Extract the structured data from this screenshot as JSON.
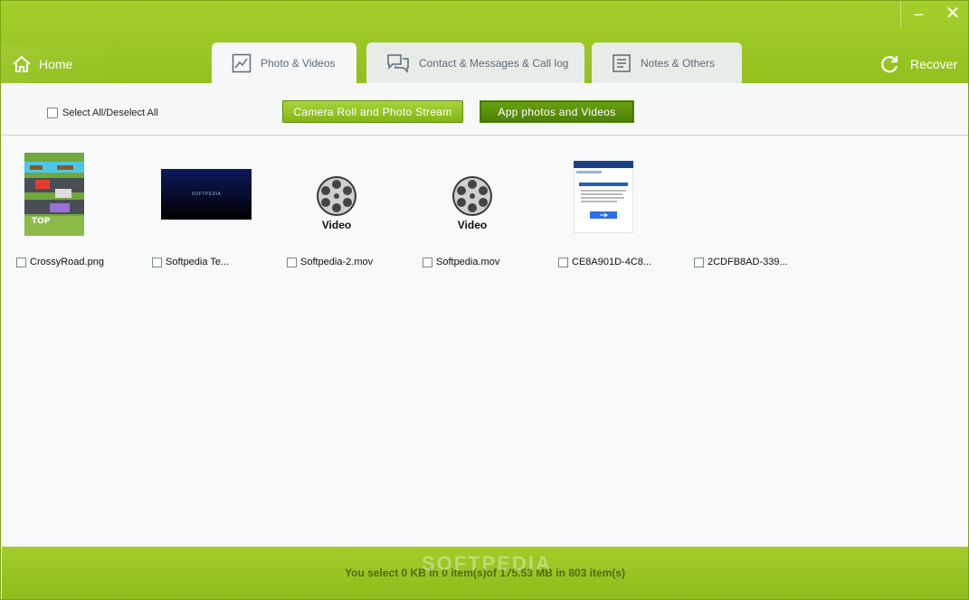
{
  "window": {
    "minimize_glyph": "–",
    "close_glyph": "✕"
  },
  "nav": {
    "home_label": "Home",
    "recover_label": "Recover",
    "tabs": [
      {
        "label": "Photo & Videos",
        "icon": "photo-icon",
        "active": true
      },
      {
        "label": "Contact & Messages & Call log",
        "icon": "messages-icon",
        "active": false
      },
      {
        "label": "Notes & Others",
        "icon": "notes-icon",
        "active": false
      }
    ]
  },
  "toolbar": {
    "select_all_label": "Select All/Deselect All",
    "camera_roll_label": "Camera Roll and Photo Stream",
    "app_photos_label": "App photos and Videos"
  },
  "items": [
    {
      "name": "CrossyRoad.png",
      "type": "image"
    },
    {
      "name": "Softpedia Te...",
      "type": "image",
      "thumb_text": "SOFTPEDIA"
    },
    {
      "name": "Softpedia-2.mov",
      "type": "video",
      "video_label": "Video"
    },
    {
      "name": "Softpedia.mov",
      "type": "video",
      "video_label": "Video"
    },
    {
      "name": "CE8A901D-4C8...",
      "type": "image"
    },
    {
      "name": "2CDFB8AD-339...",
      "type": "image"
    }
  ],
  "status": {
    "text": "You select 0 KB in 0 item(s)of 175.53 MB in 803 item(s)"
  },
  "watermark": "SOFTPEDIA",
  "colors": {
    "brand_green": "#9ac823",
    "dark_green_button": "#5a8e0d"
  }
}
